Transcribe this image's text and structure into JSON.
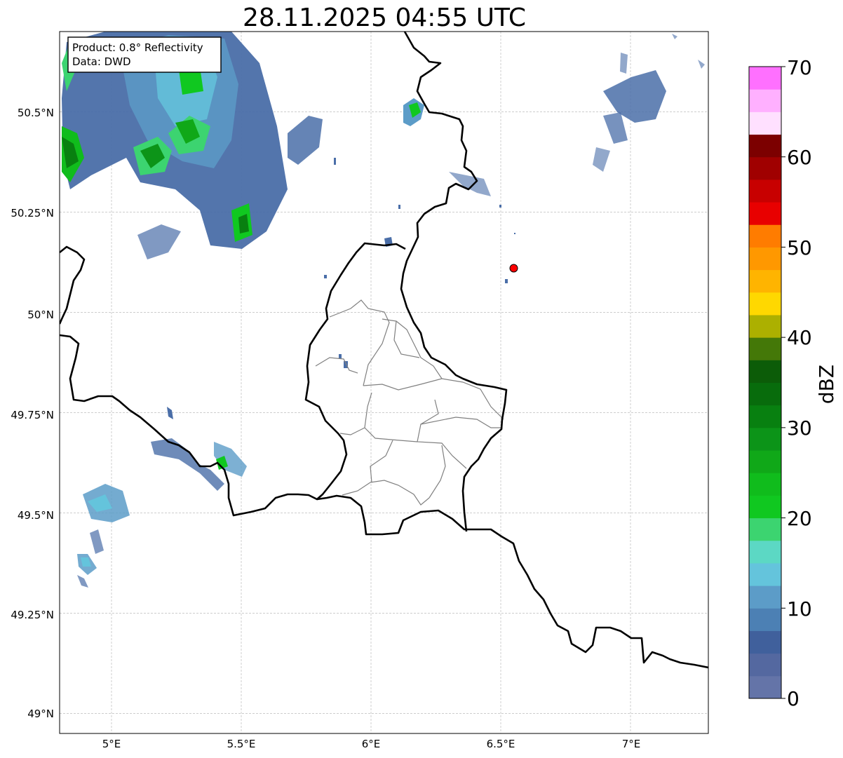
{
  "map": {
    "title": "28.11.2025 04:55 UTC",
    "info_box": {
      "product": "Product: 0.8° Reflectivity",
      "data": "Data: DWD"
    },
    "lat_ticks": [
      "50.5°N",
      "50.25°N",
      "50°N",
      "49.75°N",
      "49.5°N",
      "49.25°N",
      "49°N"
    ],
    "lon_ticks": [
      "5°E",
      "5.5°E",
      "6°E",
      "6.5°E",
      "7°E"
    ],
    "gridlines": true,
    "extent": {
      "lon_min": 4.8,
      "lon_max": 7.3,
      "lat_min": 48.95,
      "lat_max": 50.7
    },
    "station_marker": {
      "lon": 6.55,
      "lat": 50.11,
      "color": "#ff0000"
    },
    "colors": {
      "country_border": "#000000",
      "admin_border": "#808080",
      "grid": "#b0b0b0"
    }
  },
  "colorbar": {
    "label": "dBZ",
    "ticks": [
      "0",
      "10",
      "20",
      "30",
      "40",
      "50",
      "60",
      "70"
    ],
    "min": 0,
    "max": 70,
    "step": 2.5,
    "colors": [
      "#6474a8",
      "#5468a0",
      "#40609c",
      "#4c80b4",
      "#5c9cc8",
      "#64c4dc",
      "#5cd8c4",
      "#3cd470",
      "#10c820",
      "#10bc1c",
      "#10a818",
      "#0c9418",
      "#088010",
      "#086c0c",
      "#0c5c08",
      "#447808",
      "#acb000",
      "#ffd800",
      "#ffb400",
      "#ff9800",
      "#ff7c00",
      "#e80000",
      "#c80000",
      "#a00000",
      "#7c0000",
      "#ffe0ff",
      "#ffb0ff",
      "#ff70ff",
      "#e840ec"
    ]
  }
}
